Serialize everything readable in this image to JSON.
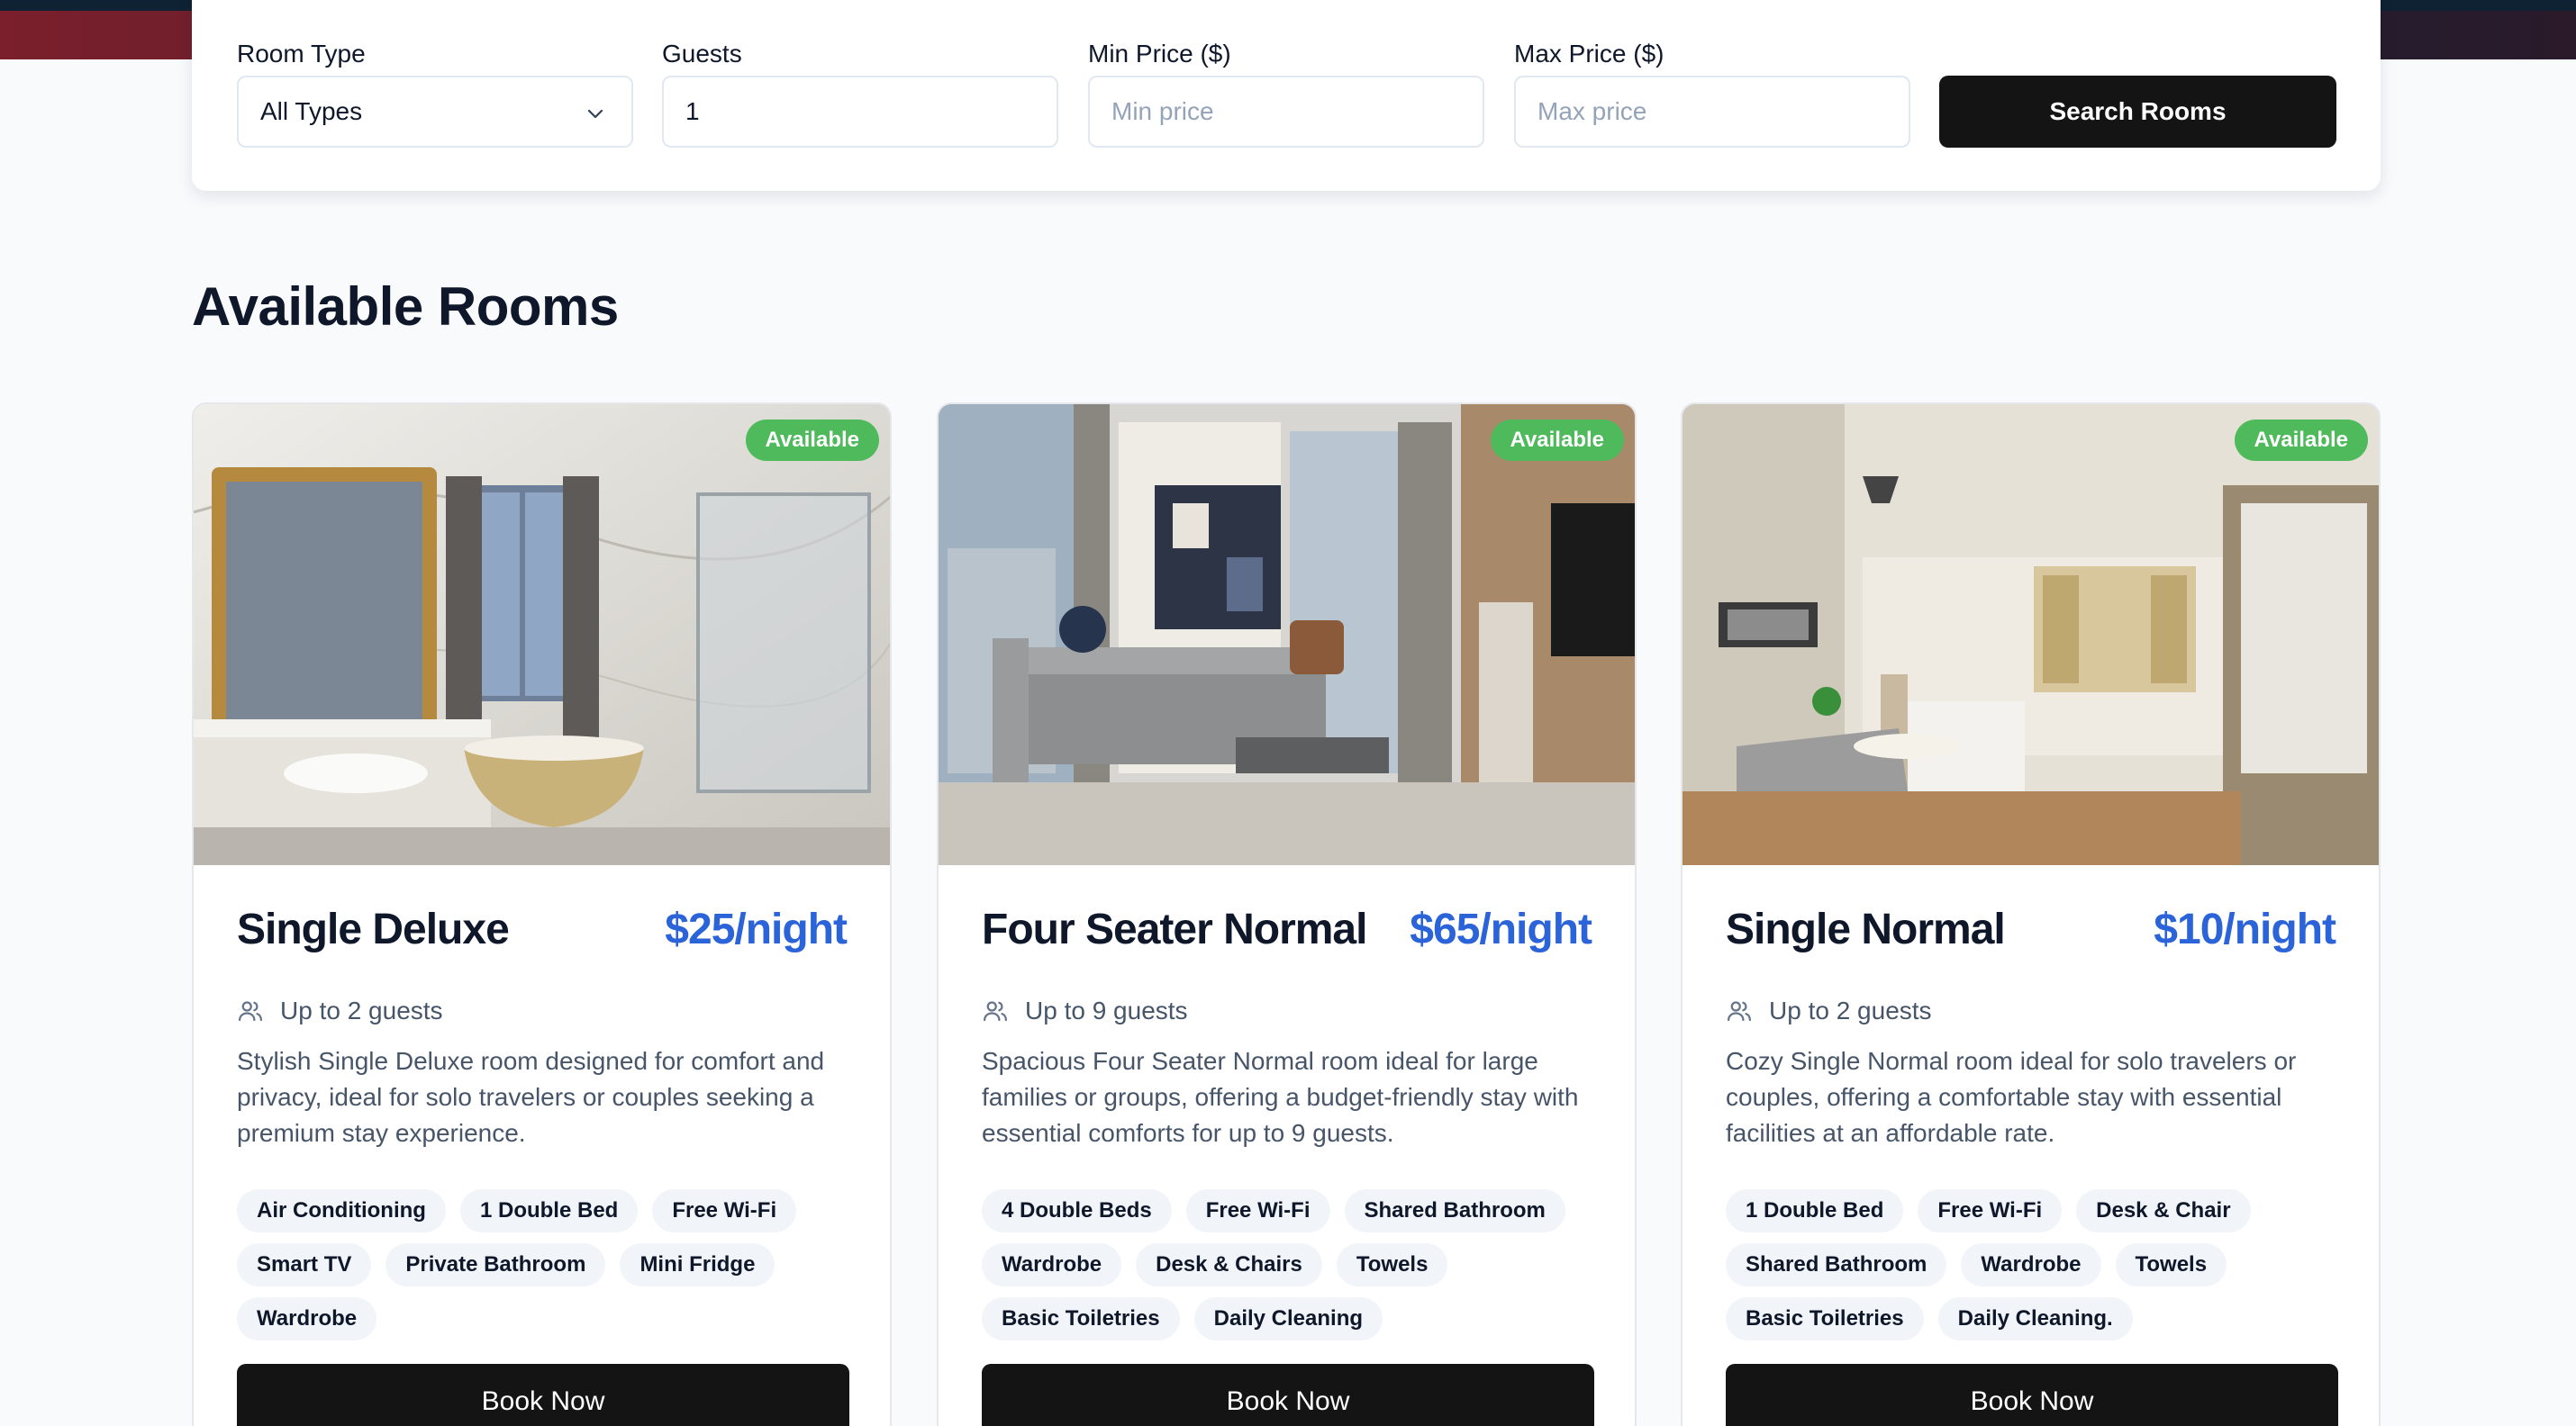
{
  "search": {
    "room_type_label": "Room Type",
    "room_type_value": "All Types",
    "guests_label": "Guests",
    "guests_value": "1",
    "min_price_label": "Min Price ($)",
    "min_price_placeholder": "Min price",
    "max_price_label": "Max Price ($)",
    "max_price_placeholder": "Max price",
    "button_label": "Search Rooms"
  },
  "section_title": "Available Rooms",
  "rooms": [
    {
      "badge": "Available",
      "name": "Single Deluxe",
      "price": "$25/night",
      "guests": "Up to 2 guests",
      "description": "Stylish Single Deluxe room designed for comfort and privacy, ideal for solo travelers or couples seeking a premium stay experience.",
      "amenities": [
        "Air Conditioning",
        "1 Double Bed",
        "Free Wi-Fi",
        "Smart TV",
        "Private Bathroom",
        "Mini Fridge",
        "Wardrobe"
      ],
      "book_label": "Book Now"
    },
    {
      "badge": "Available",
      "name": "Four Seater Normal",
      "price": "$65/night",
      "guests": "Up to 9 guests",
      "description": "Spacious Four Seater Normal room ideal for large families or groups, offering a budget-friendly stay with essential comforts for up to 9 guests.",
      "amenities": [
        "4 Double Beds",
        "Free Wi-Fi",
        "Shared Bathroom",
        "Wardrobe",
        "Desk & Chairs",
        "Towels",
        "Basic Toiletries",
        "Daily Cleaning"
      ],
      "book_label": "Book Now"
    },
    {
      "badge": "Available",
      "name": "Single Normal",
      "price": "$10/night",
      "guests": "Up to 2 guests",
      "description": "Cozy Single Normal room ideal for solo travelers or couples, offering a comfortable stay with essential facilities at an affordable rate.",
      "amenities": [
        "1 Double Bed",
        "Free Wi-Fi",
        "Desk & Chair",
        "Shared Bathroom",
        "Wardrobe",
        "Towels",
        "Basic Toiletries",
        "Daily Cleaning."
      ],
      "book_label": "Book Now"
    }
  ],
  "colors": {
    "accent_price": "#2b63d9",
    "badge_green": "#4fba5c",
    "button_dark": "#141414"
  }
}
